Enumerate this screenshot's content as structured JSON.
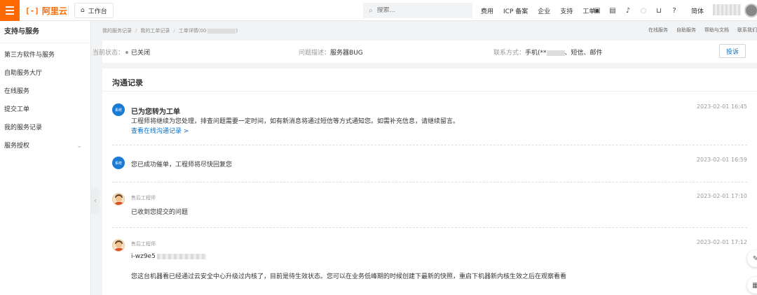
{
  "topbar": {
    "logo_mark": "[-]",
    "logo_text": "阿里云",
    "workbench_label": "工作台",
    "search_placeholder": "搜索...",
    "nav_links": [
      "费用",
      "ICP 备案",
      "企业",
      "支持",
      "工单"
    ],
    "lang_label": "简体",
    "icons": [
      "console-icon",
      "message-icon",
      "bell-icon",
      "bulb-icon",
      "cart-icon",
      "help-icon"
    ]
  },
  "sidebar": {
    "title": "支持与服务",
    "items": [
      {
        "label": "第三方软件与服务"
      },
      {
        "label": "自助服务大厅"
      },
      {
        "label": "在线服务"
      },
      {
        "label": "提交工单"
      },
      {
        "label": "我的服务记录"
      },
      {
        "label": "服务授权",
        "chevron": "⌄"
      }
    ]
  },
  "breadcrumb": {
    "items": [
      "我的服务记录",
      "我的工单记录",
      "工单详情(00"
    ],
    "suffix": ")"
  },
  "right_links": [
    "在线服务",
    "自助服务",
    "帮助与文档",
    "联系我们"
  ],
  "status": {
    "state_label": "当前状态：",
    "state_value": "已关闭",
    "desc_label": "问题描述：",
    "desc_value": "服务器BUG",
    "contact_label": "联系方式：",
    "contact_prefix": "手机(**",
    "contact_suffix": "、短信、邮件",
    "complain_label": "投诉"
  },
  "card": {
    "title": "沟通记录"
  },
  "records": [
    {
      "type": "system",
      "badge": "系统",
      "title": "已为您转为工单",
      "text": "工程师将继续为您处理，排查问题需要一定时间，如有新消息将通过短信等方式通知您。如需补充信息，请继续留言。",
      "link": "查看在线沟通记录 >",
      "time": "2023-02-01 16:45"
    },
    {
      "type": "system",
      "badge": "系统",
      "text": "您已成功催单，工程师将尽快回复您",
      "time": "2023-02-01 16:59"
    },
    {
      "type": "engineer",
      "sender": "售后工程师",
      "text": "已收到您提交的问题",
      "time": "2023-02-01 17:10"
    },
    {
      "type": "engineer",
      "sender": "售后工程师",
      "id_prefix": "i-wz9e5",
      "text": "您这台机器看已经通过云安全中心升级过内核了，目前是待生效状态。您可以在业务低峰期的时候创建下最新的快照，重启下机器新内核生效之后在观察看看",
      "time": "2023-02-01 17:12"
    }
  ]
}
